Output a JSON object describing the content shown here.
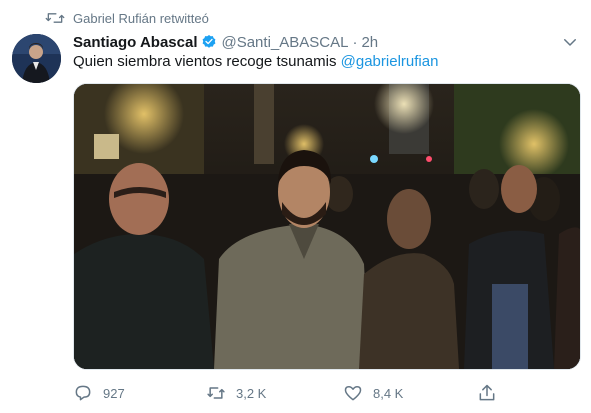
{
  "retweet_context": {
    "text": "Gabriel Rufián retwitteó",
    "icon": "retweet-icon"
  },
  "tweet": {
    "author_name": "Santiago Abascal",
    "author_handle": "@Santi_ABASCAL",
    "separator": "·",
    "timestamp": "2h",
    "text": "Quien siembra vientos recoge tsunamis",
    "mention": "@gabrielrufian",
    "verified": true
  },
  "media": {
    "type": "video",
    "description_icon": "video-thumbnail"
  },
  "actions": {
    "reply": {
      "icon": "reply-icon",
      "count": "927"
    },
    "retweet": {
      "icon": "retweet-icon",
      "count": "3,2 K"
    },
    "like": {
      "icon": "heart-icon",
      "count": "8,4 K"
    },
    "share": {
      "icon": "share-icon"
    }
  },
  "colors": {
    "accent": "#1b95e0",
    "muted": "#657786",
    "text": "#14171a"
  }
}
